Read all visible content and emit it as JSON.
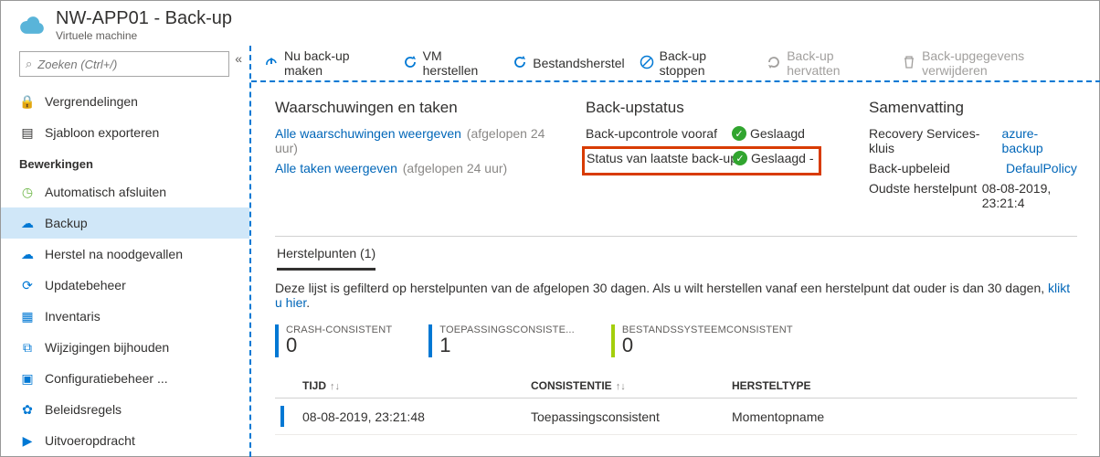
{
  "header": {
    "title": "NW-APP01 - Back-up",
    "subtitle": "Virtuele machine"
  },
  "search": {
    "placeholder": "Zoeken (Ctrl+/)"
  },
  "sidebar": {
    "top": [
      {
        "icon": "lock",
        "label": "Vergrendelingen"
      },
      {
        "icon": "template",
        "label": "Sjabloon exporteren"
      }
    ],
    "section": "Bewerkingen",
    "items": [
      {
        "icon": "clock",
        "label": "Automatisch afsluiten"
      },
      {
        "icon": "cloud",
        "label": "Backup",
        "active": true
      },
      {
        "icon": "cloud",
        "label": "Herstel na noodgevallen"
      },
      {
        "icon": "update",
        "label": "Updatebeheer"
      },
      {
        "icon": "inventory",
        "label": "Inventaris"
      },
      {
        "icon": "track",
        "label": "Wijzigingen bijhouden"
      },
      {
        "icon": "config",
        "label": "Configuratiebeheer ..."
      },
      {
        "icon": "policy",
        "label": "Beleidsregels"
      },
      {
        "icon": "runcmd",
        "label": "Uitvoeropdracht"
      }
    ]
  },
  "toolbar": {
    "backup_now": "Nu back-up maken",
    "restore_vm": "VM herstellen",
    "file_recovery": "Bestandsherstel",
    "stop_backup": "Back-up stoppen",
    "resume_backup": "Back-up hervatten",
    "delete_data": "Back-upgegevens verwijderen"
  },
  "alerts": {
    "heading": "Waarschuwingen en taken",
    "view_alerts": "Alle waarschuwingen weergeven",
    "view_jobs": "Alle taken weergeven",
    "suffix": "(afgelopen 24 uur)"
  },
  "status": {
    "heading": "Back-upstatus",
    "precheck_label": "Back-upcontrole vooraf",
    "precheck_value": "Geslaagd",
    "last_label": "Status van laatste back-up",
    "last_value": "Geslaagd -"
  },
  "summary": {
    "heading": "Samenvatting",
    "vault_k": "Recovery Services-kluis",
    "vault_v": "azure-backup",
    "policy_k": "Back-upbeleid",
    "policy_v": "DefaulPolicy",
    "oldest_k": "Oudste herstelpunt",
    "oldest_v": "08-08-2019, 23:21:4"
  },
  "restore": {
    "tab_label": "Herstelpunten (1)",
    "hint_pre": "Deze lijst is gefilterd op herstelpunten van de afgelopen 30 dagen. Als u wilt herstellen vanaf een herstelpunt dat ouder is dan 30 dagen, ",
    "hint_link": "klikt u hier",
    "stats": [
      {
        "label": "CRASH-CONSISTENT",
        "value": "0",
        "color": "blue"
      },
      {
        "label": "TOEPASSINGSCONSISTE...",
        "value": "1",
        "color": "blue"
      },
      {
        "label": "BESTANDSSYSTEEMCONSISTENT",
        "value": "0",
        "color": "green"
      }
    ],
    "columns": {
      "time": "TIJD",
      "consistency": "CONSISTENTIE",
      "type": "HERSTELTYPE"
    },
    "rows": [
      {
        "time": "08-08-2019, 23:21:48",
        "consistency": "Toepassingsconsistent",
        "type": "Momentopname"
      }
    ]
  }
}
